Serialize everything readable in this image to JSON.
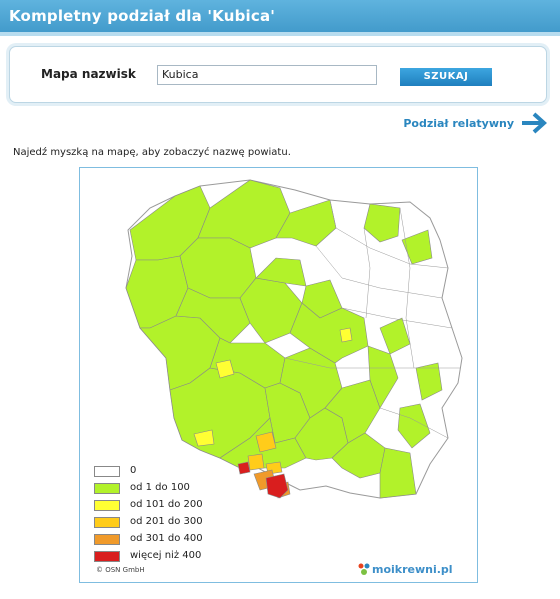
{
  "header": {
    "title": "Kompletny podział dla 'Kubica'"
  },
  "search": {
    "label": "Mapa nazwisk",
    "value": "Kubica",
    "button": "SZUKAJ"
  },
  "relative_link": "Podział relatywny",
  "hint": "Najedź myszką na mapę, aby zobaczyć nazwę powiatu.",
  "legend": [
    {
      "label": "0",
      "color": "#ffffff"
    },
    {
      "label": "od 1 do 100",
      "color": "#b2f22a"
    },
    {
      "label": "od 101 do 200",
      "color": "#ffff33"
    },
    {
      "label": "od 201 do 300",
      "color": "#ffcc1a"
    },
    {
      "label": "od 301 do 400",
      "color": "#f09a2a"
    },
    {
      "label": "więcej niż 400",
      "color": "#d91e1e"
    }
  ],
  "copyright": "© OSN GmbH",
  "brand": "moikrewni.pl"
}
